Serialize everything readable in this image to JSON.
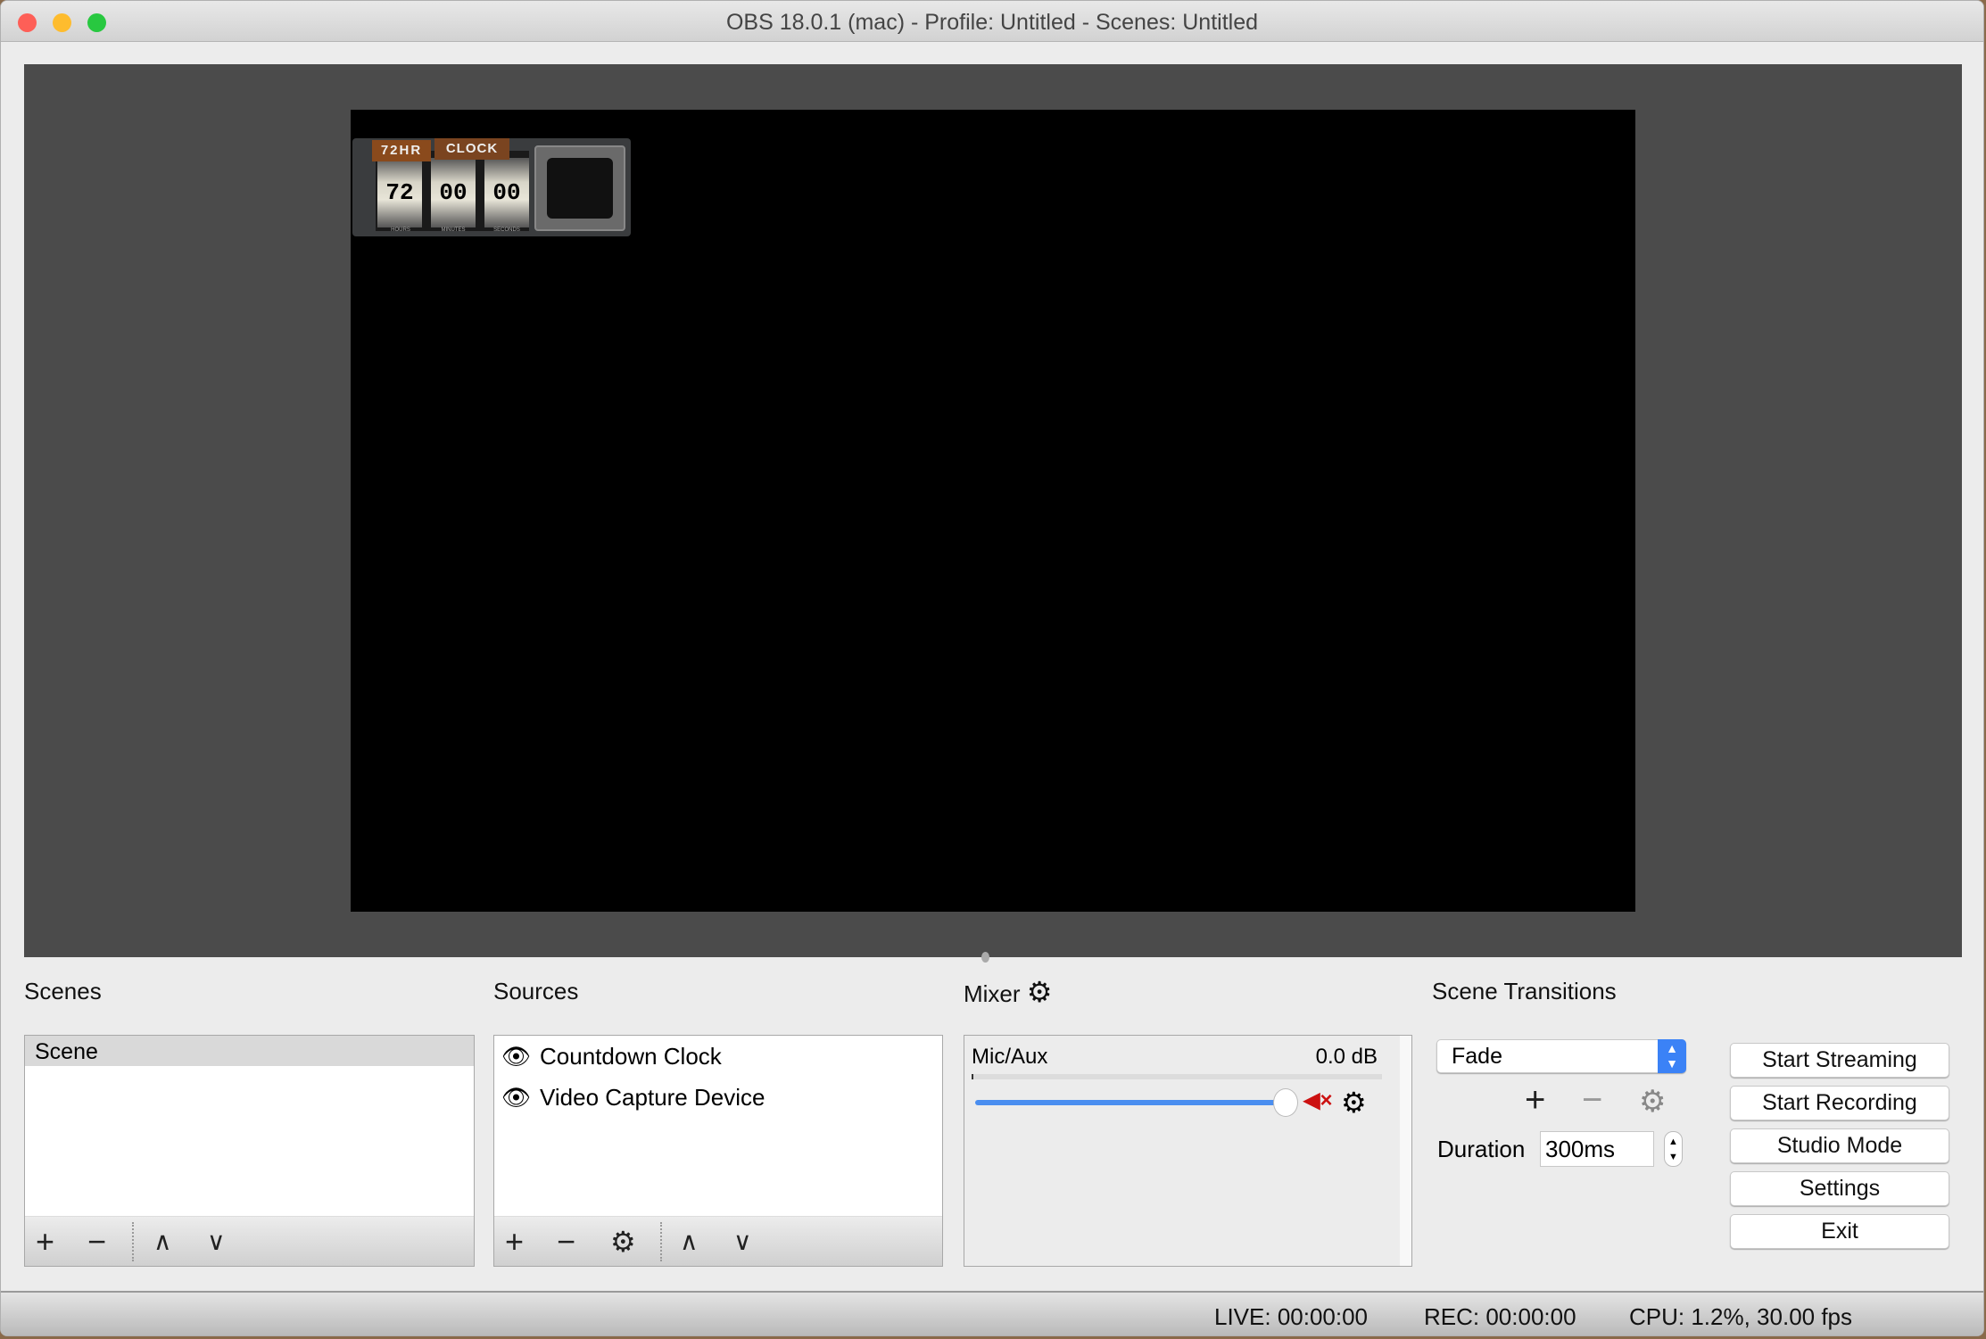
{
  "window": {
    "title": "OBS 18.0.1 (mac) - Profile: Untitled - Scenes: Untitled"
  },
  "preview": {
    "clock": {
      "badge_left": "72HR",
      "badge_right": "CLOCK",
      "hours": "72",
      "minutes": "00",
      "seconds": "00",
      "hours_label": "HOURS",
      "minutes_label": "MINUTES",
      "seconds_label": "SECONDS"
    }
  },
  "scenes": {
    "title": "Scenes",
    "items": [
      "Scene"
    ],
    "selected": 0
  },
  "sources": {
    "title": "Sources",
    "items": [
      "Countdown Clock",
      "Video Capture Device"
    ]
  },
  "mixer": {
    "title": "Mixer",
    "channel": "Mic/Aux",
    "level": "0.0 dB",
    "volume_percent": 100,
    "muted": true
  },
  "transitions": {
    "title": "Scene Transitions",
    "selected": "Fade",
    "duration_label": "Duration",
    "duration": "300ms"
  },
  "controls": {
    "start_streaming": "Start Streaming",
    "start_recording": "Start Recording",
    "studio_mode": "Studio Mode",
    "settings": "Settings",
    "exit": "Exit"
  },
  "status": {
    "live": "LIVE: 00:00:00",
    "rec": "REC: 00:00:00",
    "cpu": "CPU: 1.2%, 30.00 fps"
  },
  "colors": {
    "accent": "#3b82f6",
    "mute": "#cc1111"
  }
}
